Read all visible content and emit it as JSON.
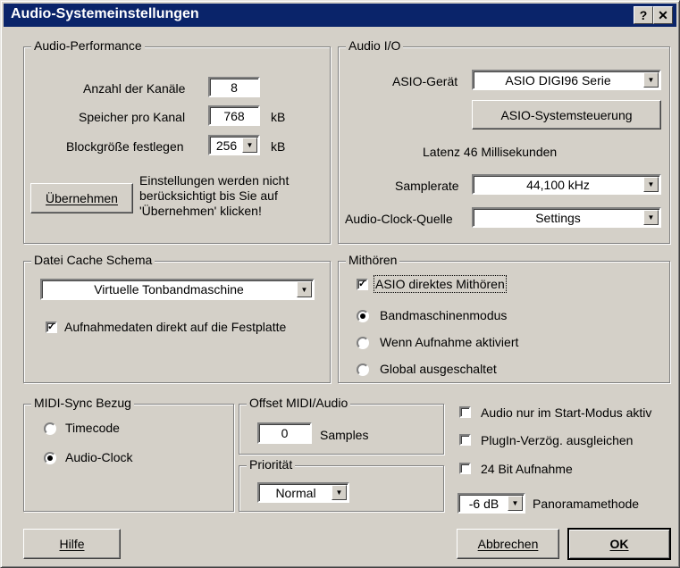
{
  "window": {
    "title": "Audio-Systemeinstellungen",
    "help_glyph": "?",
    "close_glyph": "✕"
  },
  "audio_performance": {
    "legend": "Audio-Performance",
    "channels_label": "Anzahl der Kanäle",
    "channels_value": "8",
    "memory_label": "Speicher pro Kanal",
    "memory_value": "768",
    "memory_unit": "kB",
    "block_label": "Blockgröße festlegen",
    "block_value": "256",
    "block_unit": "kB",
    "apply_button": "Übernehmen",
    "note_line1": "Einstellungen werden nicht",
    "note_line2": "berücksichtigt bis Sie auf",
    "note_line3": "'Übernehmen' klicken!"
  },
  "audio_io": {
    "legend": "Audio I/O",
    "asio_label": "ASIO-Gerät",
    "asio_value": "ASIO DIGI96 Serie",
    "control_button": "ASIO-Systemsteuerung",
    "latency": "Latenz 46 Millisekunden",
    "samplerate_label": "Samplerate",
    "samplerate_value": "44,100 kHz",
    "clock_label": "Audio-Clock-Quelle",
    "clock_value": "Settings"
  },
  "file_cache": {
    "legend": "Datei Cache Schema",
    "scheme_value": "Virtuelle Tonbandmaschine",
    "direct_record_label": "Aufnahmedaten direkt auf die Festplatte",
    "direct_record_checked": true
  },
  "monitoring": {
    "legend": "Mithören",
    "asio_direct_label": "ASIO direktes Mithören",
    "asio_direct_checked": true,
    "options": [
      "Bandmaschinenmodus",
      "Wenn Aufnahme aktiviert",
      "Global ausgeschaltet"
    ],
    "selected": "Bandmaschinenmodus"
  },
  "midi_sync": {
    "legend": "MIDI-Sync Bezug",
    "options": [
      "Timecode",
      "Audio-Clock"
    ],
    "selected": "Audio-Clock"
  },
  "offset": {
    "legend": "Offset MIDI/Audio",
    "value": "0",
    "unit": "Samples"
  },
  "priority": {
    "legend": "Priorität",
    "value": "Normal"
  },
  "options": {
    "audio_start_only": "Audio nur im Start-Modus aktiv",
    "plugin_delay": "PlugIn-Verzög. ausgleichen",
    "bit24": "24 Bit Aufnahme",
    "pan_value": "-6 dB",
    "pan_label": "Panoramamethode"
  },
  "buttons": {
    "help": "Hilfe",
    "cancel": "Abbrechen",
    "ok": "OK"
  },
  "colors": {
    "face": "#d4d0c8",
    "title_bar": "#0a246a"
  }
}
